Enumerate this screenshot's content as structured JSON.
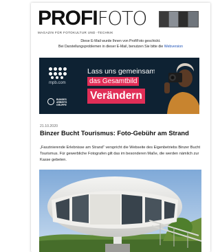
{
  "masthead": {
    "logo_bold": "PROFI",
    "logo_light": "FOTO",
    "tagline": "MAGAZIN FÜR FOTOKULTUR UND -TECHNIK"
  },
  "notice": {
    "line1": "Diese E-Mail wurde Ihnen von ProfiFoto geschickt.",
    "line2_prefix": "Bei Darstellungsproblemen in dieser E-Mail, benutzen Sie bitte die",
    "web_version_link": "Webversion"
  },
  "banner": {
    "brand_url": "mpb.com",
    "line1": "Lass uns gemeinsam",
    "line2": "das Gesamtbild",
    "cta": "Verändern",
    "partner": "BUNDES ARBEITS GRUPPE",
    "colors": {
      "background": "#0e2233",
      "accent": "#e12e57"
    }
  },
  "article": {
    "date": "21.10.2020",
    "title": "Binzer Bucht Tourismus: Foto-Gebühr am Strand",
    "body": "„Faszinierende Erlebnisse am Strand“ verspricht die Webseite des Eigenbetriebs Binzer Bucht Tourismus. Für gewerbliche Fotografen gilt das im besonderen Maße, die werden nämlich zur Kasse gebeten."
  },
  "icons": [
    "magazine-covers-icon",
    "mpb-logo-icon",
    "photographer-illustration",
    "rettungsturm-photo"
  ]
}
